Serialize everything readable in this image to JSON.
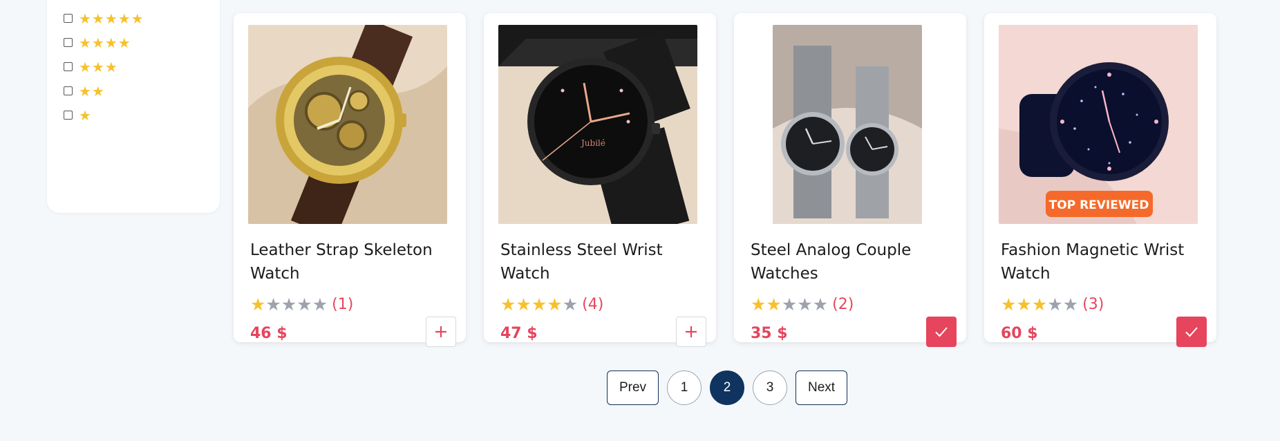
{
  "filters": {
    "ratings": [
      {
        "stars": "★★★★★"
      },
      {
        "stars": "★★★★"
      },
      {
        "stars": "★★★"
      },
      {
        "stars": "★★"
      },
      {
        "stars": "★"
      }
    ]
  },
  "products": [
    {
      "title": "Leather Strap Skeleton Watch",
      "rating": 1,
      "reviews": "(1)",
      "price": "46 $",
      "in_cart": false,
      "image": "gold skeleton watch with brown leather strap"
    },
    {
      "title": "Stainless Steel Wrist Watch",
      "rating": 4,
      "reviews": "(4)",
      "price": "47 $",
      "in_cart": false,
      "image": "black stainless steel watch"
    },
    {
      "title": "Steel Analog Couple Watches",
      "rating": 2,
      "reviews": "(2)",
      "price": "35 $",
      "in_cart": true,
      "image": "pair of silver steel watches"
    },
    {
      "title": "Fashion Magnetic Wrist Watch",
      "rating": 3,
      "reviews": "(3)",
      "price": "60 $",
      "in_cart": true,
      "image": "starry dial magnetic watch",
      "badge": "TOP REVIEWED"
    }
  ],
  "pagination": {
    "prev": "Prev",
    "pages": [
      "1",
      "2",
      "3"
    ],
    "current": "2",
    "next": "Next"
  },
  "colors": {
    "accent": "#e6455d",
    "star": "#f7c12d",
    "navy": "#0f3460",
    "background": "#f5f8fb"
  },
  "icons": {
    "add": "plus-icon",
    "added": "check-icon",
    "star": "star-icon"
  }
}
